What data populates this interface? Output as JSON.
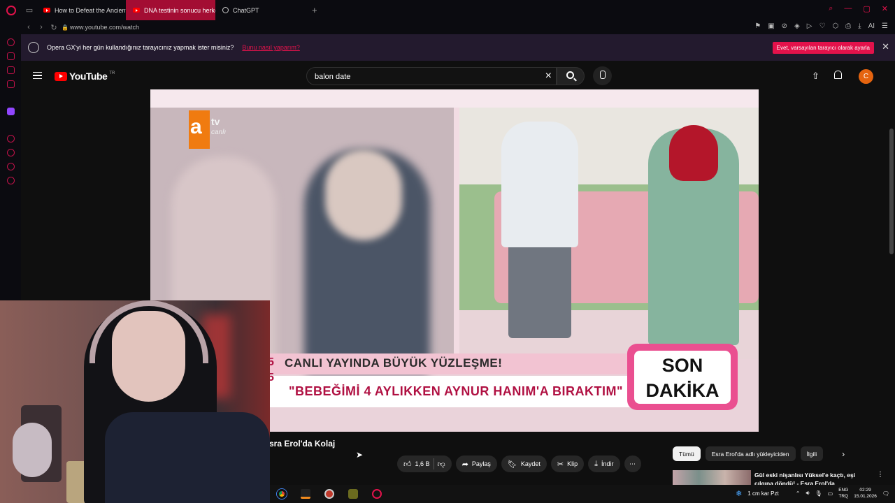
{
  "browser": {
    "tabs": [
      {
        "label": "How to Defeat the Ancient",
        "icon": "youtube-icon",
        "active": false
      },
      {
        "label": "DNA testinin sonucu herkes",
        "icon": "youtube-icon",
        "active": true
      },
      {
        "label": "ChatGPT",
        "icon": "chatgpt-icon",
        "active": false
      }
    ],
    "url": "www.youtube.com/watch",
    "accent_color": "#e3124b"
  },
  "notification": {
    "message": "Opera GX'yi her gün kullandığınız tarayıcınız yapmak ister misiniz?",
    "link": "Bunu nasıl yaparım?",
    "button": "Evet, varsayılan tarayıcı olarak ayarla",
    "close": "✕"
  },
  "youtube": {
    "logo_text": "YouTube",
    "region": "TR",
    "search_value": "balon date",
    "avatar_letter": "C"
  },
  "video": {
    "channel_logo": "a",
    "channel_logo_tv": "tv",
    "channel_logo_sub": "canlı",
    "banner_line1": "CANLI YAYINDA BÜYÜK YÜZLEŞME!",
    "banner_line2": "\"BEBEĞİMİ 4 AYLIKKEN AYNUR HANIM'A BIRAKTIM\"",
    "banner_numbers": "5 5",
    "badge_line1": "SON",
    "badge_line2": "DAKİKA",
    "title": "sra Erol'da Kolaj"
  },
  "actions": {
    "like_count": "1,6 B",
    "share": "Paylaş",
    "save": "Kaydet",
    "clip": "Klip",
    "download": "İndir",
    "more": "⋯"
  },
  "chips": [
    "Tümü",
    "Esra Erol'da adlı yükleyiciden",
    "İlgili"
  ],
  "recommendation": {
    "title": "Gül eski nişanlısı Yüksel'e kaçtı, eşi çılgına döndü! - Esra Erol'da"
  },
  "taskbar": {
    "weather": "1 cm kar Pzt",
    "lang_top": "ENG",
    "lang_bottom": "TRQ",
    "time": "02:29",
    "date": "15.01.2026"
  }
}
